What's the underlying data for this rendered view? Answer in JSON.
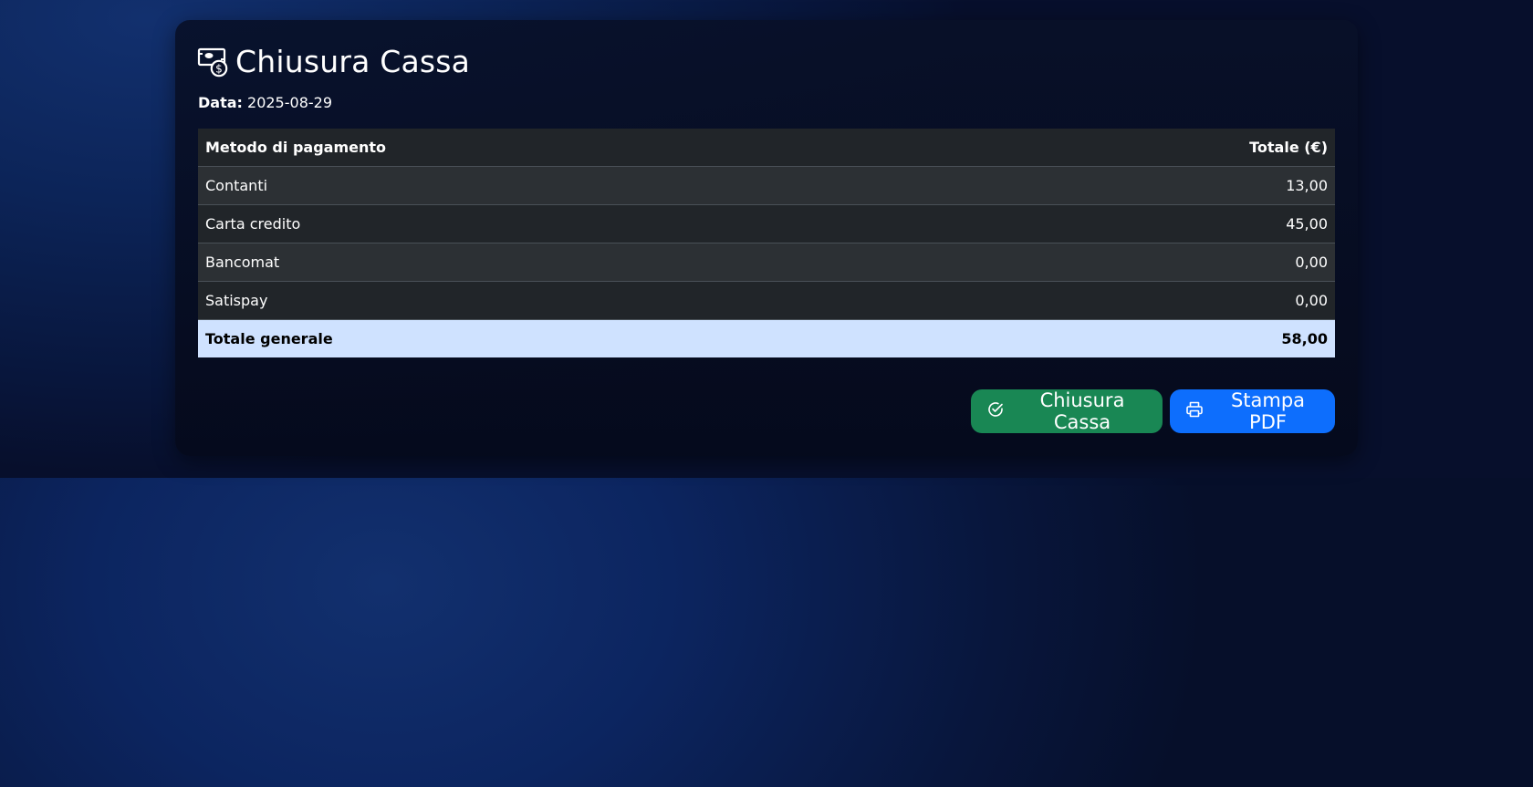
{
  "page": {
    "title": "Chiusura Cassa",
    "title_icon": "cash-coin-icon"
  },
  "date": {
    "label": "Data:",
    "value": "2025-08-29"
  },
  "table": {
    "columns": [
      "Metodo di pagamento",
      "Totale (€)"
    ],
    "rows": [
      {
        "method": "Contanti",
        "total": "13,00"
      },
      {
        "method": "Carta credito",
        "total": "45,00"
      },
      {
        "method": "Bancomat",
        "total": "0,00"
      },
      {
        "method": "Satispay",
        "total": "0,00"
      }
    ],
    "footer": {
      "label": "Totale generale",
      "total": "58,00"
    }
  },
  "actions": {
    "close_register": {
      "label": "Chiusura Cassa",
      "icon": "check-circle-icon",
      "color": "#198754"
    },
    "print_pdf": {
      "label": "Stampa PDF",
      "icon": "printer-icon",
      "color": "#0d6efd"
    }
  }
}
